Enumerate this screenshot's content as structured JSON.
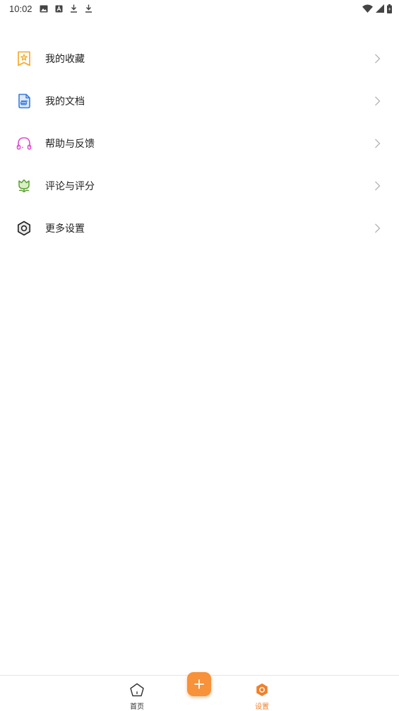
{
  "status_bar": {
    "time": "10:02",
    "icons": [
      "image-icon",
      "a-icon",
      "download-icon",
      "download-icon",
      "wifi-icon",
      "signal-icon",
      "battery-icon"
    ]
  },
  "menu": {
    "items": [
      {
        "label": "我的收藏",
        "icon": "favorites-star-icon",
        "color": "#f5a623"
      },
      {
        "label": "我的文档",
        "icon": "document-icon",
        "color": "#3b7ddd"
      },
      {
        "label": "帮助与反馈",
        "icon": "headset-icon",
        "color": "#e04ccf"
      },
      {
        "label": "评论与评分",
        "icon": "tulip-icon",
        "color": "#5aa02c"
      },
      {
        "label": "更多设置",
        "icon": "hex-settings-icon",
        "color": "#222222"
      }
    ]
  },
  "bottom_nav": {
    "home_label": "首页",
    "settings_label": "设置",
    "active": "settings",
    "accent_color": "#f0812a"
  }
}
